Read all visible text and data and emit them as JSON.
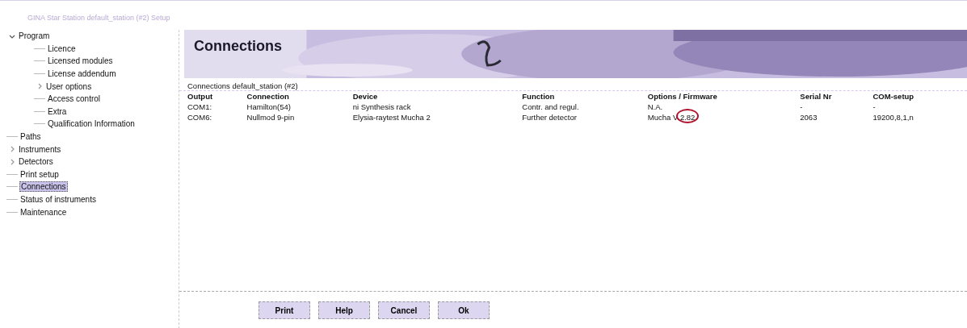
{
  "window": {
    "title": "GINA Star Station default_station (#2) Setup"
  },
  "tree": [
    {
      "label": "Program",
      "expandable": true,
      "expanded": true,
      "selected": false,
      "children": [
        {
          "label": "Licence",
          "selected": false
        },
        {
          "label": "Licensed modules",
          "selected": false
        },
        {
          "label": "License addendum",
          "selected": false
        },
        {
          "label": "User options",
          "expandable": true,
          "expanded": false,
          "selected": false
        },
        {
          "label": "Access control",
          "selected": false
        },
        {
          "label": "Extra",
          "selected": false
        },
        {
          "label": "Qualification Information",
          "selected": false
        }
      ]
    },
    {
      "label": "Paths",
      "selected": false
    },
    {
      "label": "Instruments",
      "expandable": true,
      "expanded": false,
      "selected": false
    },
    {
      "label": "Detectors",
      "expandable": true,
      "expanded": false,
      "selected": false
    },
    {
      "label": "Print setup",
      "selected": false
    },
    {
      "label": "Connections",
      "selected": true
    },
    {
      "label": "Status of instruments",
      "selected": false
    },
    {
      "label": "Maintenance",
      "selected": false
    }
  ],
  "banner": {
    "title": "Connections"
  },
  "table": {
    "caption": "Connections default_station (#2)",
    "columns": [
      "Output",
      "Connection",
      "Device",
      "Function",
      "Options / Firmware",
      "Serial Nr",
      "COM-setup"
    ],
    "rows": [
      [
        {
          "text": "COM1:",
          "circled": false
        },
        {
          "text": "Hamilton(54)",
          "circled": false
        },
        {
          "text": "ni Synthesis rack",
          "circled": false
        },
        {
          "text": "Contr. and regul.",
          "circled": false
        },
        {
          "text": "N.A.",
          "circled": false
        },
        {
          "text": "-",
          "circled": false
        },
        {
          "text": "-",
          "circled": false
        }
      ],
      [
        {
          "text": "COM6:",
          "circled": false
        },
        {
          "text": "Nullmod 9-pin",
          "circled": false
        },
        {
          "text": "Elysia-raytest Mucha 2",
          "circled": false
        },
        {
          "text": "Further detector",
          "circled": false
        },
        {
          "text": "Mucha V 2.82",
          "circled": true
        },
        {
          "text": "2063",
          "circled": false
        },
        {
          "text": "19200,8,1,n",
          "circled": false
        }
      ]
    ]
  },
  "buttons": [
    "Print",
    "Help",
    "Cancel",
    "Ok"
  ]
}
